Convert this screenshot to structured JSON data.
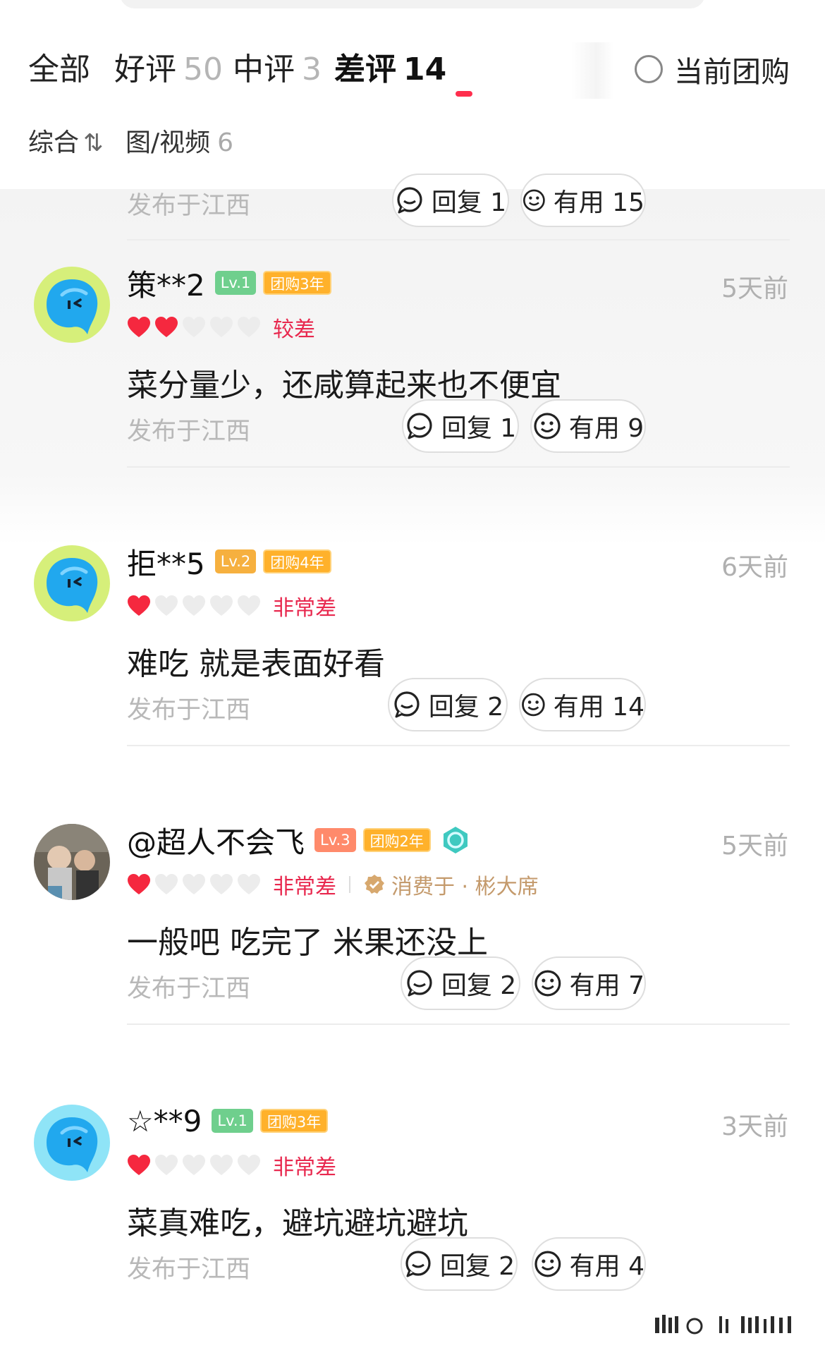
{
  "tabs": [
    {
      "label": "全部",
      "count": ""
    },
    {
      "label": "好评",
      "count": "50"
    },
    {
      "label": "中评",
      "count": "3"
    },
    {
      "label": "差评",
      "count": "14",
      "active": true
    }
  ],
  "filter_current": {
    "label": "当前团购",
    "checked": false
  },
  "subfilters": {
    "sort": {
      "label": "综合",
      "icon": "⇅"
    },
    "media": {
      "label": "图/视频",
      "count": "6"
    }
  },
  "top_footer": {
    "location": "发布于江西",
    "reply": "回复 1",
    "useful": "有用 15"
  },
  "reviews": [
    {
      "username": "策**2",
      "level": "Lv.1",
      "years": "团购3年",
      "time": "5天前",
      "hearts": 2,
      "rating_text": "较差",
      "comment": "菜分量少，还咸算起来也不便宜",
      "location": "发布于江西",
      "reply": "回复 1",
      "useful": "有用 9"
    },
    {
      "username": "拒**5",
      "level": "Lv.2",
      "years": "团购4年",
      "time": "6天前",
      "hearts": 1,
      "rating_text": "非常差",
      "comment": "难吃 就是表面好看",
      "location": "发布于江西",
      "reply": "回复 2",
      "useful": "有用 14"
    },
    {
      "username": "@超人不会飞",
      "level": "Lv.3",
      "years": "团购2年",
      "time": "5天前",
      "hearts": 1,
      "rating_text": "非常差",
      "consumed": "消费于 · 彬大席",
      "comment": "一般吧 吃完了 米果还没上",
      "location": "发布于江西",
      "reply": "回复 2",
      "useful": "有用 7"
    },
    {
      "username": "☆**9",
      "level": "Lv.1",
      "years": "团购3年",
      "time": "3天前",
      "hearts": 1,
      "rating_text": "非常差",
      "comment": "菜真难吃，避坑避坑避坑",
      "location": "发布于江西",
      "reply": "回复 2",
      "useful": "有用 4"
    }
  ],
  "colors": {
    "accent": "#ff2e4d",
    "heart_filled": "#f5283f",
    "heart_empty": "#ececec",
    "rating_text": "#e8284e"
  }
}
